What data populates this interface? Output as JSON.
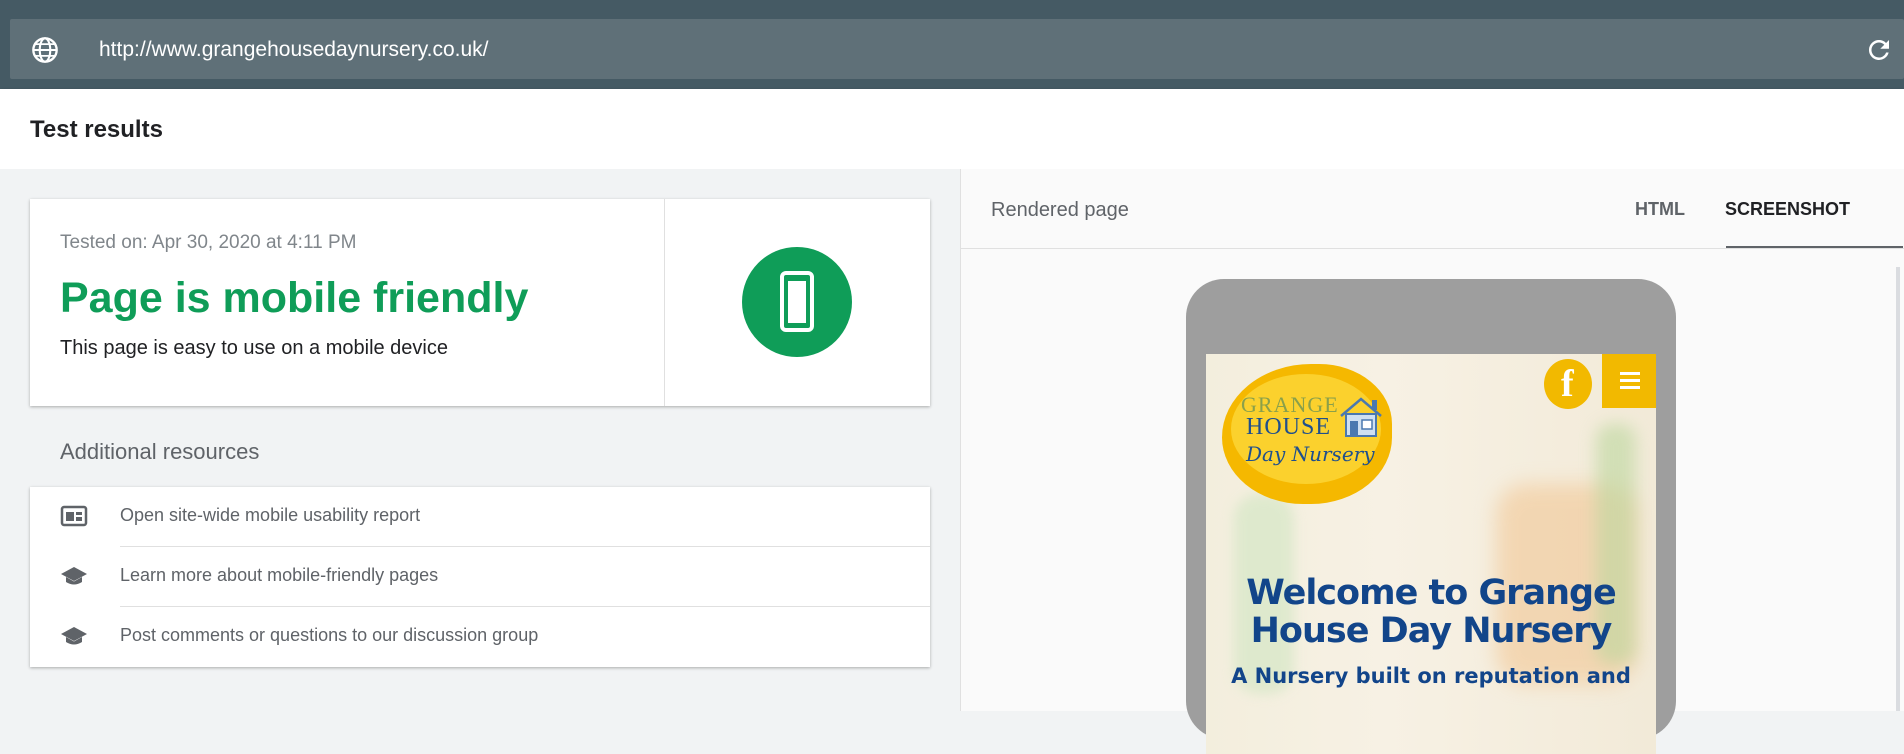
{
  "address_bar": {
    "url": "http://www.grangehousedaynursery.co.uk/"
  },
  "results_header": {
    "title": "Test results"
  },
  "summary_card": {
    "tested_on": "Tested on: Apr 30, 2020 at 4:11 PM",
    "headline": "Page is mobile friendly",
    "description": "This page is easy to use on a mobile device",
    "accent_color": "#0f9d58",
    "icon": "smartphone-icon"
  },
  "additional_resources": {
    "heading": "Additional resources",
    "items": [
      {
        "label": "Open site-wide mobile usability report",
        "icon": "report-icon"
      },
      {
        "label": "Learn more about mobile-friendly pages",
        "icon": "school-icon"
      },
      {
        "label": "Post comments or questions to our discussion group",
        "icon": "school-icon"
      }
    ]
  },
  "rendered_panel": {
    "label": "Rendered page",
    "tabs": [
      {
        "label": "HTML",
        "active": false
      },
      {
        "label": "SCREENSHOT",
        "active": true
      }
    ]
  },
  "screenshot_content": {
    "logo_line1": "GRANGE",
    "logo_line2": "HOUSE",
    "logo_line3": "Day Nursery",
    "facebook_glyph": "f",
    "heading": "Welcome to Grange House Day Nursery",
    "subheading": "A Nursery built on reputation and"
  }
}
